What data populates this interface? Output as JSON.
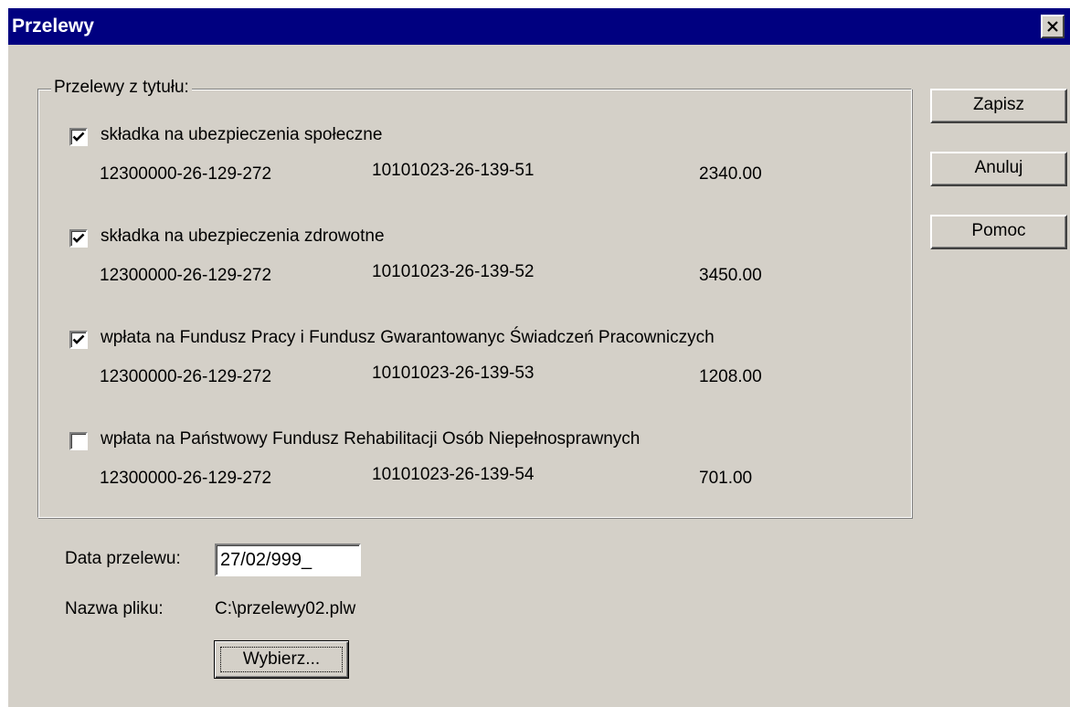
{
  "window": {
    "title": "Przelewy",
    "titlebar_color": "#000080",
    "face_color": "#d4d0c8",
    "close_icon": "close-icon"
  },
  "group": {
    "legend": "Przelewy z tytułu:",
    "items": [
      {
        "label": "składka na ubezpieczenia społeczne",
        "checked": true,
        "account_from": "12300000-26-129-272",
        "account_to": "10101023-26-139-51",
        "amount": "2340.00"
      },
      {
        "label": "składka na ubezpieczenia zdrowotne",
        "checked": true,
        "account_from": "12300000-26-129-272",
        "account_to": "10101023-26-139-52",
        "amount": "3450.00"
      },
      {
        "label": "wpłata na Fundusz Pracy i Fundusz Gwarantowanyc Świadczeń Pracowniczych",
        "checked": true,
        "account_from": "12300000-26-129-272",
        "account_to": "10101023-26-139-53",
        "amount": "1208.00"
      },
      {
        "label": "wpłata na Państwowy Fundusz Rehabilitacji Osób Niepełnosprawnych",
        "checked": false,
        "account_from": "12300000-26-129-272",
        "account_to": "10101023-26-139-54",
        "amount": "701.00"
      }
    ]
  },
  "buttons": {
    "save": "Zapisz",
    "cancel": "Anuluj",
    "help": "Pomoc",
    "browse": "Wybierz..."
  },
  "form": {
    "date_label": "Data przelewu:",
    "date_value": "27/02/999_",
    "file_label": "Nazwa pliku:",
    "file_value": "C:\\przelewy02.plw"
  }
}
